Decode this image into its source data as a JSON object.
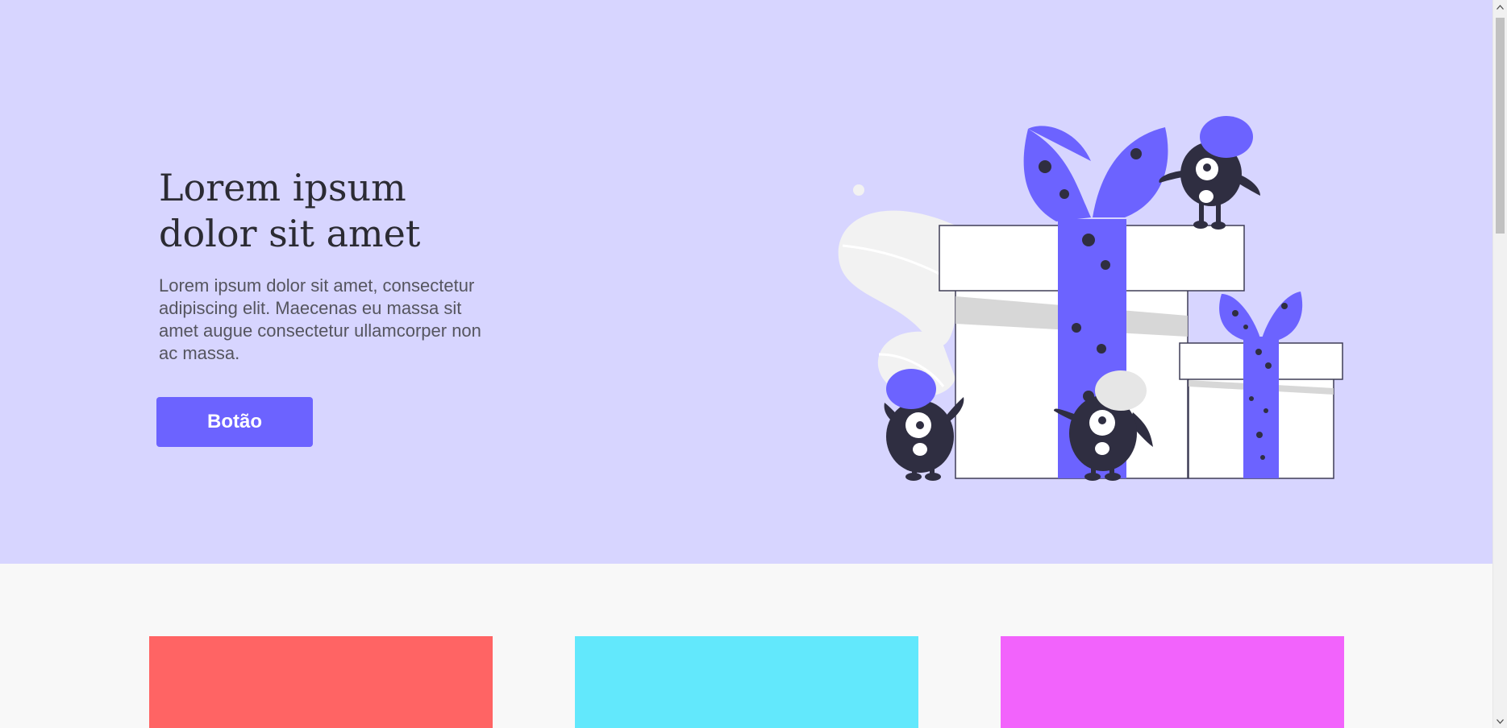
{
  "hero": {
    "title": "Lorem ipsum dolor sit amet",
    "text": "Lorem ipsum dolor sit amet, consectetur adipiscing elit. Maecenas eu massa sit amet augue consectetur ullamcorper non ac massa.",
    "button_label": "Botão",
    "background": "#d7d5ff",
    "accent": "#6c63ff",
    "illustration_icon": "gift-boxes-monsters-illustration"
  },
  "cards": [
    {
      "color": "#ff6464"
    },
    {
      "color": "#62e8fc"
    },
    {
      "color": "#f263fc"
    }
  ],
  "colors": {
    "section_background": "#f8f8f8",
    "text_dark": "#2b2b33",
    "text_body": "#55555f",
    "monster_body": "#2f2e41"
  }
}
